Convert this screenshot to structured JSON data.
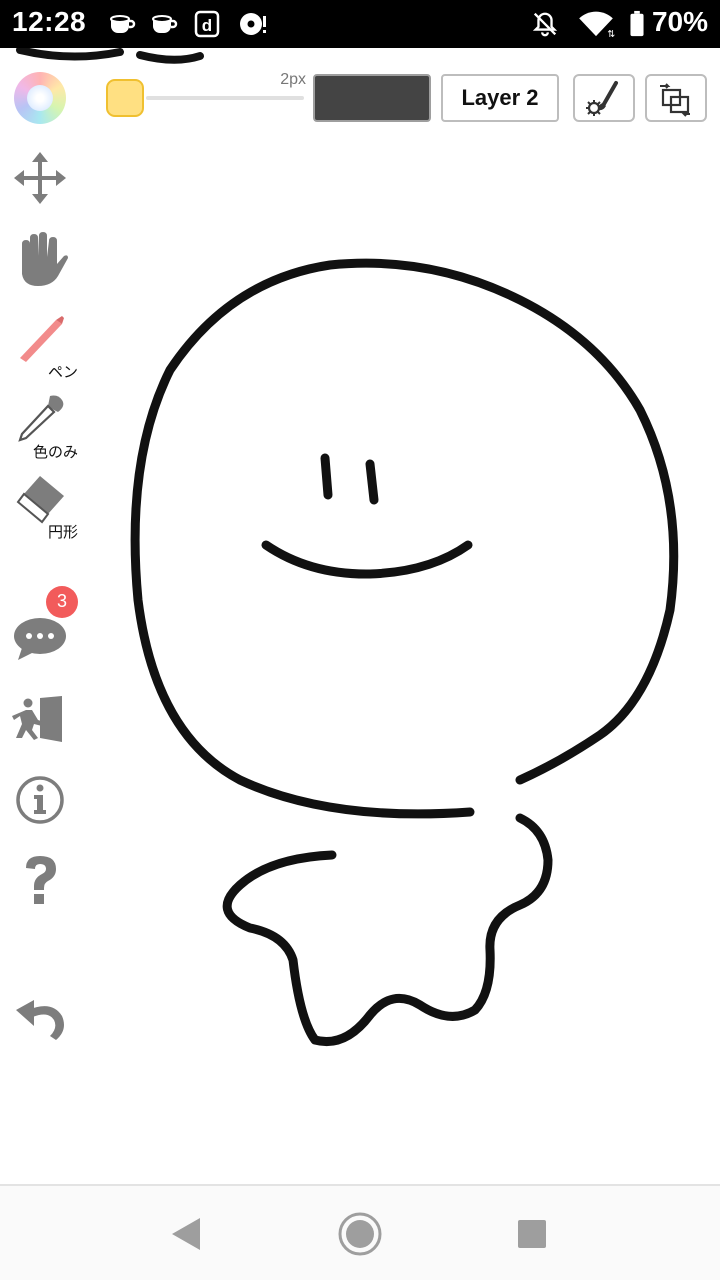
{
  "status_bar": {
    "time": "12:28",
    "battery_percent": "70%",
    "left_icons": [
      "cup-icon",
      "cup-icon",
      "d-app-icon",
      "disc-icon"
    ],
    "right_icons": [
      "bell-off-icon",
      "wifi-icon",
      "battery-icon"
    ]
  },
  "toolbar": {
    "current_color": "#ffe082",
    "pen_size_label": "2px",
    "swatch_color": "#444444",
    "layer_label": "Layer 2"
  },
  "tools": {
    "pen_label": "ペン",
    "eyedropper_label": "色のみ",
    "eraser_label": "円形",
    "chat_badge_count": "3"
  },
  "colors": {
    "pen_tool": "#f28b8b",
    "icon_gray": "#7d7d7d",
    "badge_red": "#f25b5b"
  }
}
